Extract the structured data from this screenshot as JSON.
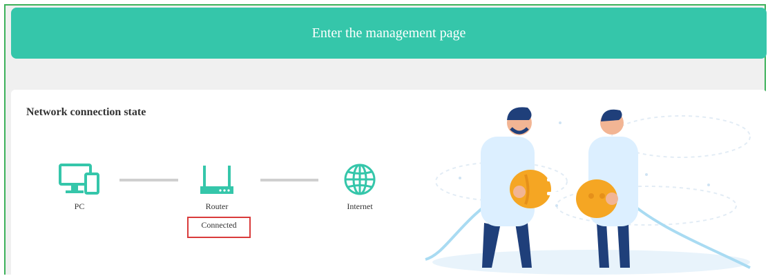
{
  "header": {
    "button_label": "Enter the management page"
  },
  "network_state": {
    "title": "Network connection state",
    "nodes": {
      "pc": {
        "label": "PC",
        "icon": "pc-monitor-icon"
      },
      "router": {
        "label": "Router",
        "icon": "router-icon"
      },
      "internet": {
        "label": "Internet",
        "icon": "globe-icon"
      }
    },
    "router_status": "Connected"
  },
  "colors": {
    "accent": "#35c6aa",
    "frame_border": "#3cb15a",
    "status_highlight": "#d93a3a",
    "illustration_orange": "#f5a623",
    "illustration_navy": "#1f3f7a"
  }
}
